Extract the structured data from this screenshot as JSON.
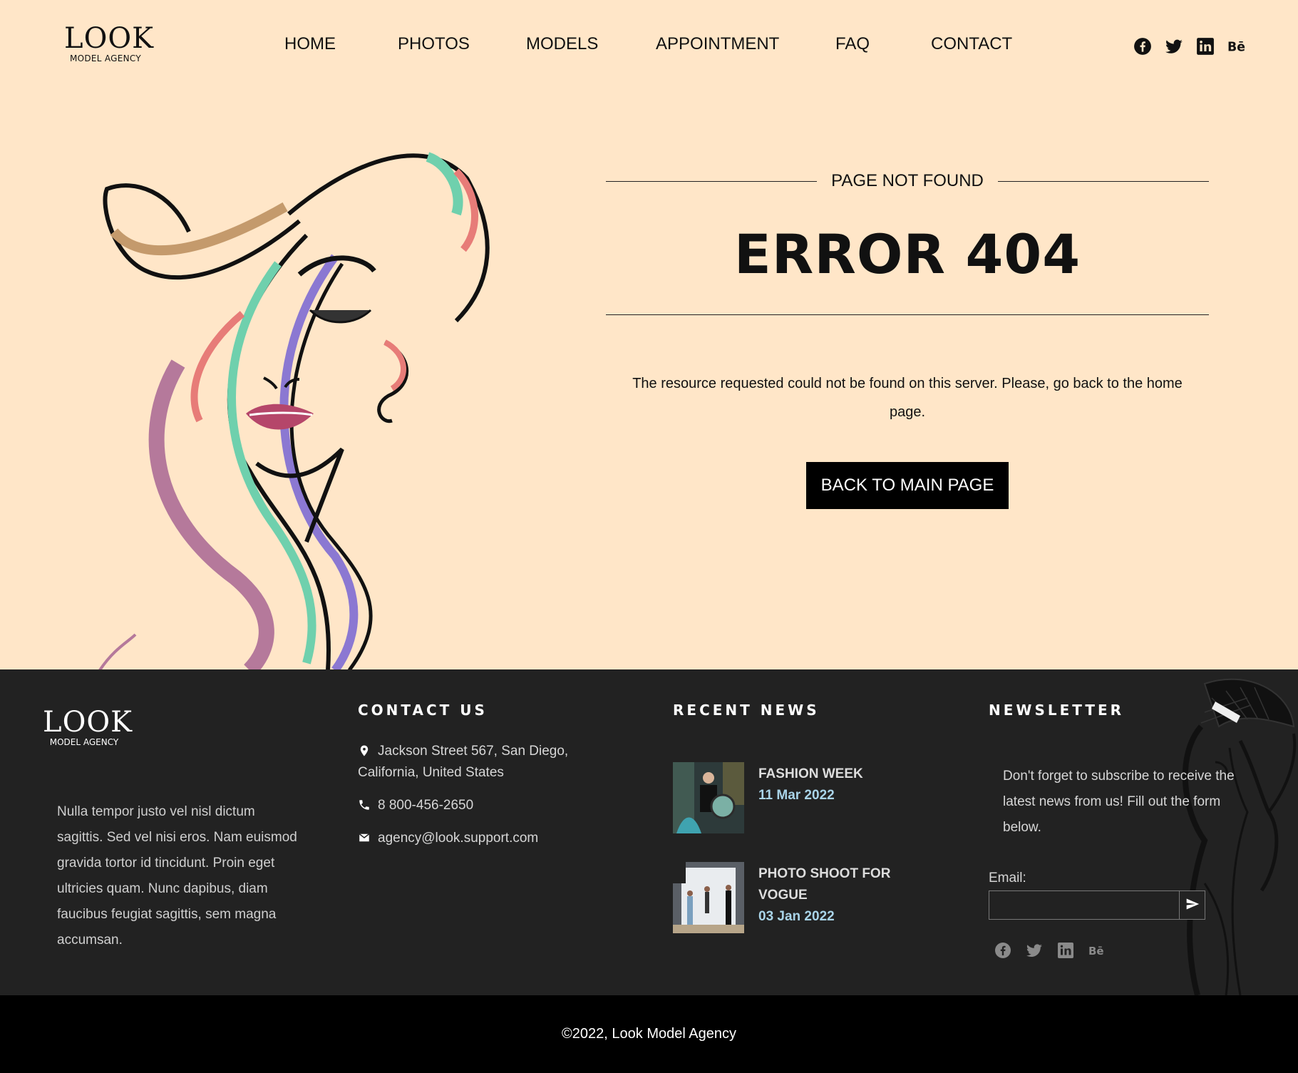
{
  "header": {
    "logo_big": "LOOK",
    "logo_small": "MODEL AGENCY",
    "nav": [
      "HOME",
      "PHOTOS",
      "MODELS",
      "APPOINTMENT",
      "FAQ",
      "CONTACT"
    ],
    "socials": [
      "facebook-icon",
      "twitter-icon",
      "linkedin-icon",
      "behance-icon"
    ]
  },
  "hero": {
    "subtitle": "PAGE NOT FOUND",
    "title": "ERROR 404",
    "message": "The resource requested could not be found on this server. Please, go back to the home page.",
    "button": "BACK TO MAIN PAGE"
  },
  "footer": {
    "logo_big": "LOOK",
    "logo_small": "MODEL AGENCY",
    "about": "Nulla tempor justo vel nisl dictum sagittis. Sed vel nisi eros. Nam euismod gravida tortor id tincidunt. Proin eget ultricies quam. Nunc dapibus, diam faucibus feugiat sagittis, sem magna accumsan.",
    "contact_heading": "CONTACT US",
    "address": "Jackson Street 567, San Diego, California, United States",
    "phone": "8 800-456-2650",
    "email": "agency@look.support.com",
    "news_heading": "RECENT NEWS",
    "news": [
      {
        "title": "FASHION WEEK",
        "date": "11 Mar 2022"
      },
      {
        "title": "PHOTO SHOOT FOR VOGUE",
        "date": "03 Jan 2022"
      }
    ],
    "newsletter_heading": "NEWSLETTER",
    "newsletter_text": "Don't forget to subscribe to receive the latest news from us! Fill out the form below.",
    "email_label": "Email:",
    "email_placeholder": "",
    "accent_date_color": "#a9d4e8"
  },
  "copyright": "©2022, Look Model Agency",
  "colors": {
    "background": "#ffe6c8",
    "footer": "#222222",
    "bottom_bar": "#000000"
  }
}
